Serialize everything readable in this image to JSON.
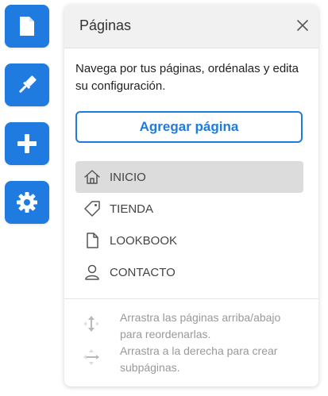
{
  "toolbar": {
    "accent": "#1f7be0",
    "buttons": [
      {
        "name": "pages",
        "icon": "page-icon"
      },
      {
        "name": "design",
        "icon": "paintbrush-icon"
      },
      {
        "name": "add",
        "icon": "plus-icon"
      },
      {
        "name": "settings",
        "icon": "gear-icon"
      }
    ]
  },
  "panel": {
    "title": "Páginas",
    "close_icon": "close-icon",
    "description": "Navega por tus páginas, ordénalas y edita su configuración.",
    "add_page_label": "Agregar página",
    "pages": [
      {
        "label": "INICIO",
        "icon": "home-icon",
        "active": true
      },
      {
        "label": "TIENDA",
        "icon": "tag-icon",
        "active": false
      },
      {
        "label": "LOOKBOOK",
        "icon": "page-icon",
        "active": false
      },
      {
        "label": "CONTACTO",
        "icon": "user-icon",
        "active": false
      }
    ],
    "hints": [
      {
        "icon": "move-vertical-icon",
        "text": "Arrastra las páginas arriba/abajo para reordenarlas."
      },
      {
        "icon": "move-all-icon",
        "text": "Arrastra a la derecha para crear subpáginas."
      }
    ]
  }
}
